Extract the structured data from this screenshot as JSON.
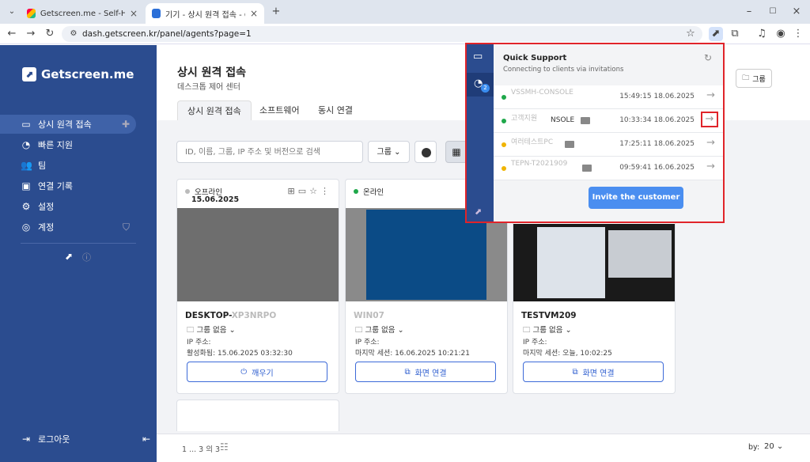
{
  "browser": {
    "tabs": [
      {
        "title": "Getscreen.me - Self-Hosted - I",
        "active": false
      },
      {
        "title": "기기 - 상시 원격 접속 - Getscr",
        "active": true
      }
    ],
    "url": "dash.getscreen.kr/panel/agents?page=1"
  },
  "sidebar": {
    "brand": "Getscreen.me",
    "items": [
      {
        "label": "상시 원격 접속",
        "icon": "devices-icon",
        "active": true
      },
      {
        "label": "빠른 지원",
        "icon": "gauge-icon",
        "active": false
      },
      {
        "label": "팀",
        "icon": "team-icon",
        "active": false
      },
      {
        "label": "연결 기록",
        "icon": "history-icon",
        "active": false
      },
      {
        "label": "설정",
        "icon": "gear-icon",
        "active": false
      },
      {
        "label": "계정",
        "icon": "account-icon",
        "active": false
      }
    ],
    "logout": "로그아웃"
  },
  "main": {
    "title": "상시 원격 접속",
    "subtitle": "데스크톱 제어 센터",
    "tabs": [
      "상시 원격 접속",
      "소프트웨어",
      "동시 연결"
    ],
    "group_button": "그룹",
    "search_placeholder": "ID, 이름, 그룹, IP 주소 및 버전으로 검색",
    "group_filter": "그룹",
    "pager_text": "1 ... 3 의 3",
    "per_page_label": "by:",
    "per_page_value": "20"
  },
  "cards": [
    {
      "status": "오프라인",
      "status_color": "#bbbbbb",
      "date": "15.06.2025",
      "name": "DESKTOP-",
      "name_blur": "XP3NRPO",
      "group": "그룹 없음",
      "ip_label": "IP 주소:",
      "line2": "활성화됨: 15.06.2025 03:32:30",
      "button": "깨우기",
      "button_icon": "power-icon",
      "thumb": "#6e6e6e"
    },
    {
      "status": "온라인",
      "status_color": "#1fa84a",
      "date": "",
      "name": "",
      "name_blur": "WIN07",
      "group": "그룹 없음",
      "ip_label": "IP 주소:",
      "line2": "마지막 세션: 16.06.2025 10:21:21",
      "button": "화면 연결",
      "button_icon": "screen-icon",
      "thumb": "#0b4b86"
    },
    {
      "status": "",
      "status_color": "#1fa84a",
      "date": "",
      "name": "TESTVM209",
      "name_blur": "",
      "group": "그룹 없음",
      "ip_label": "IP 주소:",
      "line2": "마지막 세션: 오늘, 10:02:25",
      "button": "화면 연결",
      "button_icon": "screen-icon",
      "thumb": "#1a1a1a"
    }
  ],
  "popup": {
    "title": "Quick Support",
    "subtitle": "Connecting to clients via invitations",
    "badge": "2",
    "rows": [
      {
        "dot": "#1fa84a",
        "name": "VSSMH-CONSOLE",
        "time": "15:49:15 18.06.2025"
      },
      {
        "dot": "#1fa84a",
        "name": "고객지원",
        "suffix": "NSOLE",
        "time": "10:33:34 18.06.2025"
      },
      {
        "dot": "#f0b400",
        "name": "여러테스트PC",
        "time": "17:25:11 18.06.2025"
      },
      {
        "dot": "#f0b400",
        "name": "TEPN-T2021909",
        "time": "09:59:41 16.06.2025"
      }
    ],
    "invite": "Invite the customer"
  }
}
